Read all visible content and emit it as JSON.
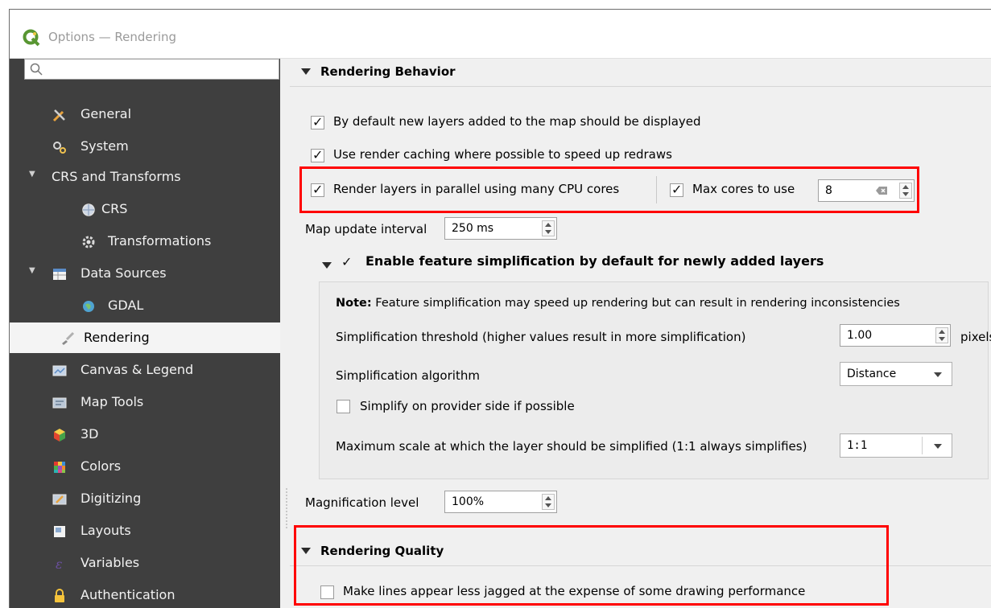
{
  "window": {
    "title": "Options — Rendering"
  },
  "search": {
    "placeholder": ""
  },
  "sidebar": {
    "items": [
      {
        "label": "General",
        "icon": "tools-icon"
      },
      {
        "label": "System",
        "icon": "system-gear-icon"
      },
      {
        "label": "CRS and Transforms",
        "icon": ""
      },
      {
        "label": "CRS",
        "icon": "globe-icon"
      },
      {
        "label": "Transformations",
        "icon": "transform-gear-icon"
      },
      {
        "label": "Data Sources",
        "icon": "table-icon"
      },
      {
        "label": "GDAL",
        "icon": "gdal-globe-icon"
      },
      {
        "label": "Rendering",
        "icon": "brush-icon"
      },
      {
        "label": "Canvas & Legend",
        "icon": "canvas-icon"
      },
      {
        "label": "Map Tools",
        "icon": "map-tools-icon"
      },
      {
        "label": "3D",
        "icon": "cube-icon"
      },
      {
        "label": "Colors",
        "icon": "palette-icon"
      },
      {
        "label": "Digitizing",
        "icon": "digitizing-icon"
      },
      {
        "label": "Layouts",
        "icon": "layouts-icon"
      },
      {
        "label": "Variables",
        "icon": "variables-icon"
      },
      {
        "label": "Authentication",
        "icon": "lock-icon"
      }
    ],
    "selected": "Rendering"
  },
  "rendering_behavior": {
    "title": "Rendering Behavior",
    "default_display": {
      "label": "By default new layers added to the map should be displayed",
      "checked": true
    },
    "render_caching": {
      "label": "Use render caching where possible to speed up redraws",
      "checked": true
    },
    "parallel": {
      "label": "Render layers in parallel using many CPU cores",
      "checked": true
    },
    "max_cores": {
      "label": "Max cores to use",
      "checked": true,
      "value": "8"
    },
    "map_update": {
      "label": "Map update interval",
      "value": "250 ms"
    }
  },
  "simplification": {
    "title": "Enable feature simplification by default for newly added layers",
    "checked": true,
    "note_bold": "Note:",
    "note_text": " Feature simplification may speed up rendering but can result in rendering inconsistencies",
    "threshold_label": "Simplification threshold (higher values result in more simplification)",
    "threshold_value": "1.00",
    "threshold_unit": "pixels",
    "algorithm_label": "Simplification algorithm",
    "algorithm_value": "Distance",
    "provider_side": {
      "label": "Simplify on provider side if possible",
      "checked": false
    },
    "max_scale_label": "Maximum scale at which the layer should be simplified (1:1 always simplifies)",
    "max_scale_value": "1:1"
  },
  "magnification": {
    "label": "Magnification level",
    "value": "100%"
  },
  "rendering_quality": {
    "title": "Rendering Quality",
    "antialias": {
      "label": "Make lines appear less jagged at the expense of some drawing performance",
      "checked": false
    }
  },
  "colors": {
    "sidebar_bg": "#3f3f3f",
    "selected_bg": "#f4f4f4",
    "highlight": "#ff0000",
    "qgis_green": "#589632"
  }
}
